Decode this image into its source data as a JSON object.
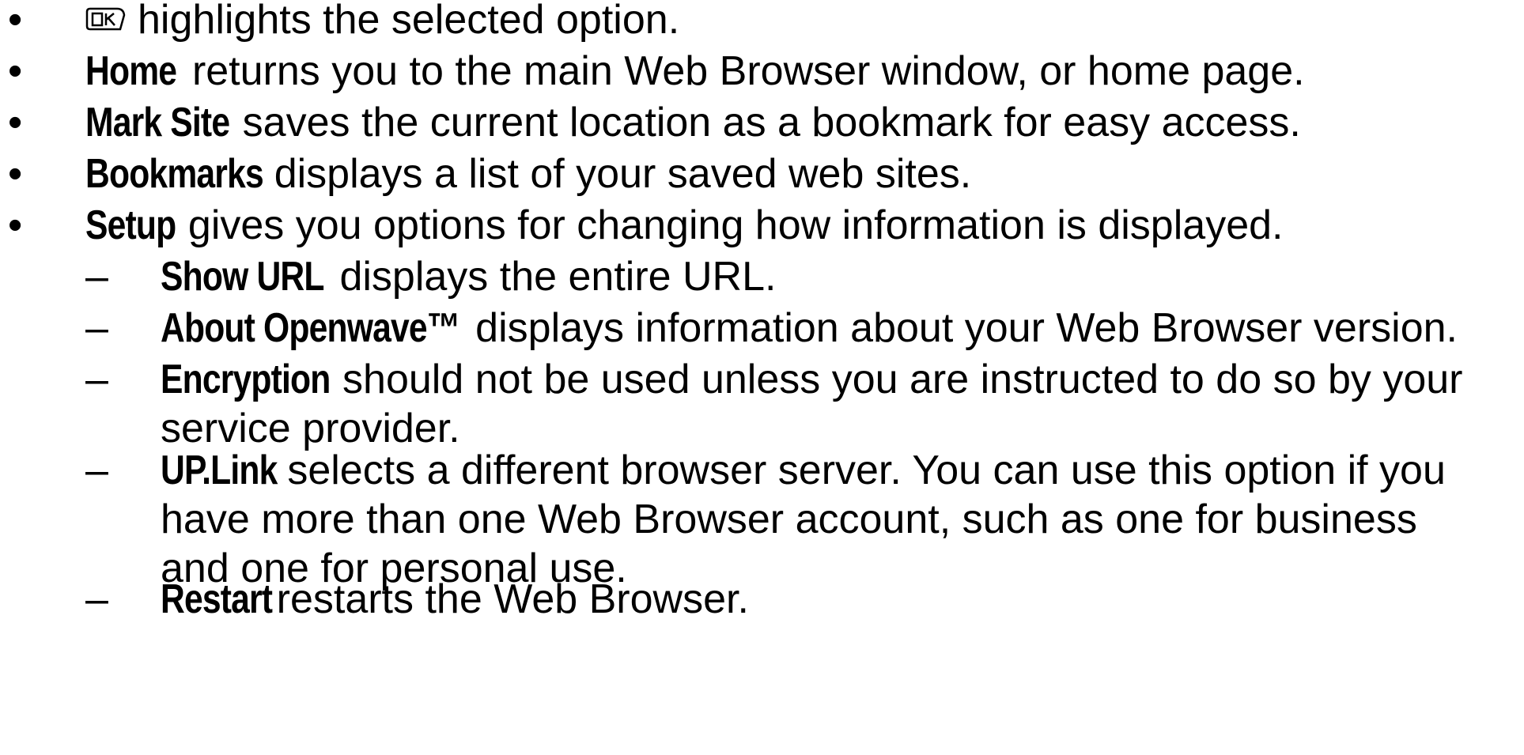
{
  "items": [
    {
      "marker": "•",
      "term": "",
      "text": "highlights the selected option.",
      "icon": "ok-button-icon"
    },
    {
      "marker": "•",
      "term": "Home",
      "text": "returns you to the main Web Browser window, or home page."
    },
    {
      "marker": "•",
      "term": "Mark Site",
      "text": "saves the current location as a bookmark for easy access."
    },
    {
      "marker": "•",
      "term": "Bookmarks",
      "text": "displays a list of your saved web sites."
    },
    {
      "marker": "•",
      "term": "Setup",
      "text": "gives you options for changing how information is displayed."
    },
    {
      "marker": "–",
      "term": "Show URL",
      "text": "displays the entire URL."
    },
    {
      "marker": "–",
      "term": "About Openwave™",
      "text": "displays information about your Web Browser version."
    },
    {
      "marker": "–",
      "term": "Encryption",
      "text": "should not be used unless you are instructed to do so by your service provider."
    },
    {
      "marker": "–",
      "term": "UP.Link",
      "text": "selects a different browser server. You can use this option if you have more than one Web Browser account, such as one for business and one for personal use."
    },
    {
      "marker": "–",
      "term": "Restart",
      "text": "restarts the Web Browser."
    }
  ]
}
